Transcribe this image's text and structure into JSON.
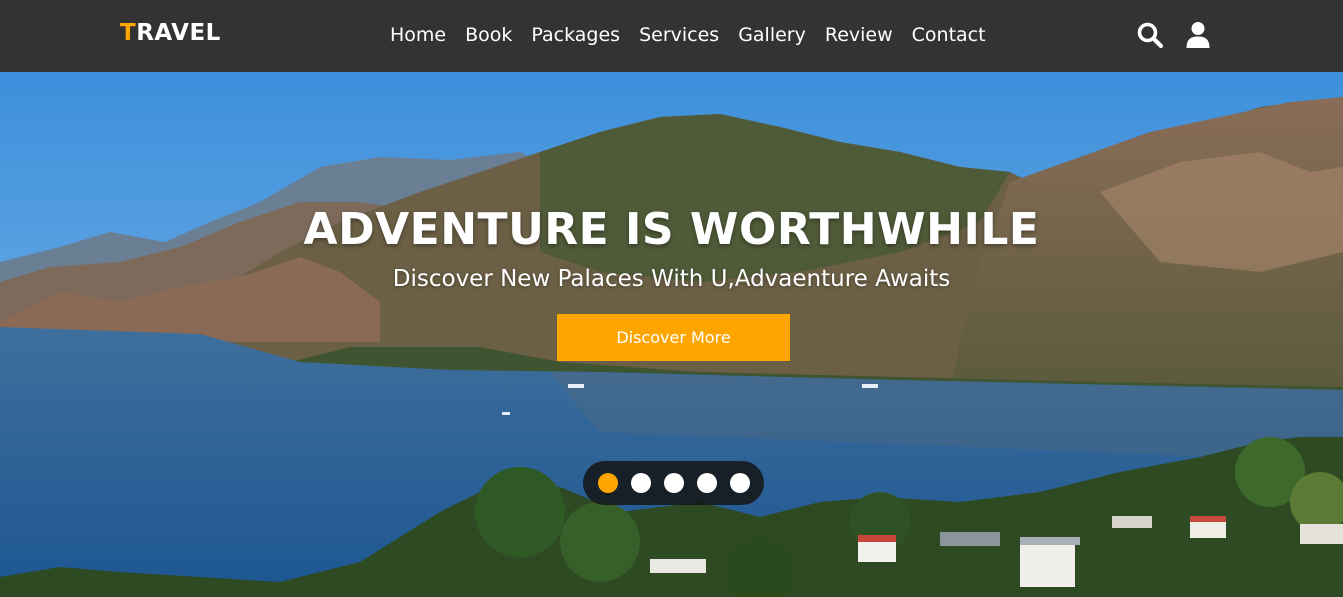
{
  "brand": {
    "first_letter": "T",
    "rest": "RAVEL",
    "accent": "#ffa500"
  },
  "nav": {
    "links": [
      {
        "label": "Home"
      },
      {
        "label": "Book"
      },
      {
        "label": "Packages"
      },
      {
        "label": "Services"
      },
      {
        "label": "Gallery"
      },
      {
        "label": "Review"
      },
      {
        "label": "Contact"
      }
    ],
    "icons": [
      "search-icon",
      "user-icon"
    ]
  },
  "hero": {
    "title": "ADVENTURE IS WORTHWHILE",
    "subtitle": "Discover New Palaces With U,Advaenture Awaits",
    "cta_label": "Discover More",
    "slides": {
      "count": 5,
      "active_index": 0
    }
  },
  "colors": {
    "navbar_bg": "#333333",
    "accent": "#ffa500",
    "text": "#ffffff"
  }
}
